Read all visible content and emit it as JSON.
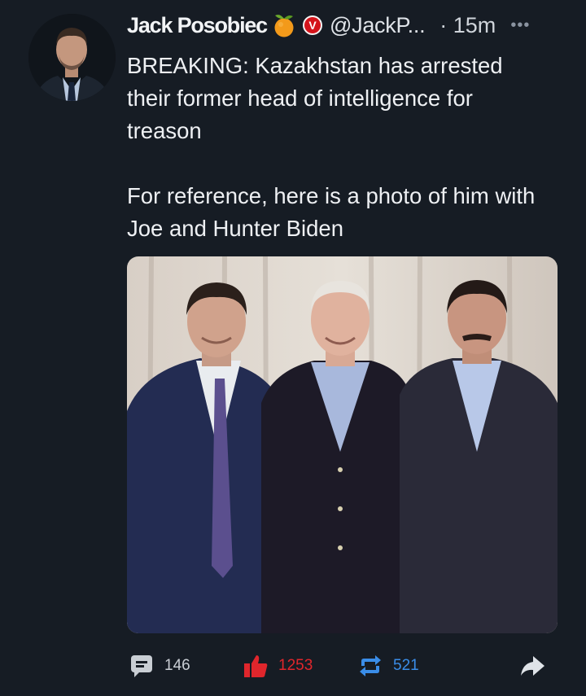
{
  "tweet": {
    "author_name": "Jack Posobiec",
    "handle": "@JackP...",
    "time": "· 15m",
    "badge_letter": "V",
    "more_glyph": "•••",
    "text_para1": "BREAKING: Kazakhstan has arrested their former head of intelligence for treason",
    "text_para2": "For reference, here is a photo of him with Joe and Hunter Biden"
  },
  "icons": {
    "author_emoji": "tangerine-icon",
    "badge": "verified-v-badge-icon",
    "comment": "comment-icon",
    "like": "thumbs-up-icon",
    "retweet": "retweet-icon",
    "share": "share-arrow-icon"
  },
  "actions": {
    "comments": "146",
    "likes": "1253",
    "retweets": "521"
  },
  "colors": {
    "background": "#161c24",
    "like_red": "#e0262c",
    "retweet_blue": "#3a8de8",
    "muted": "#c9ced4"
  }
}
